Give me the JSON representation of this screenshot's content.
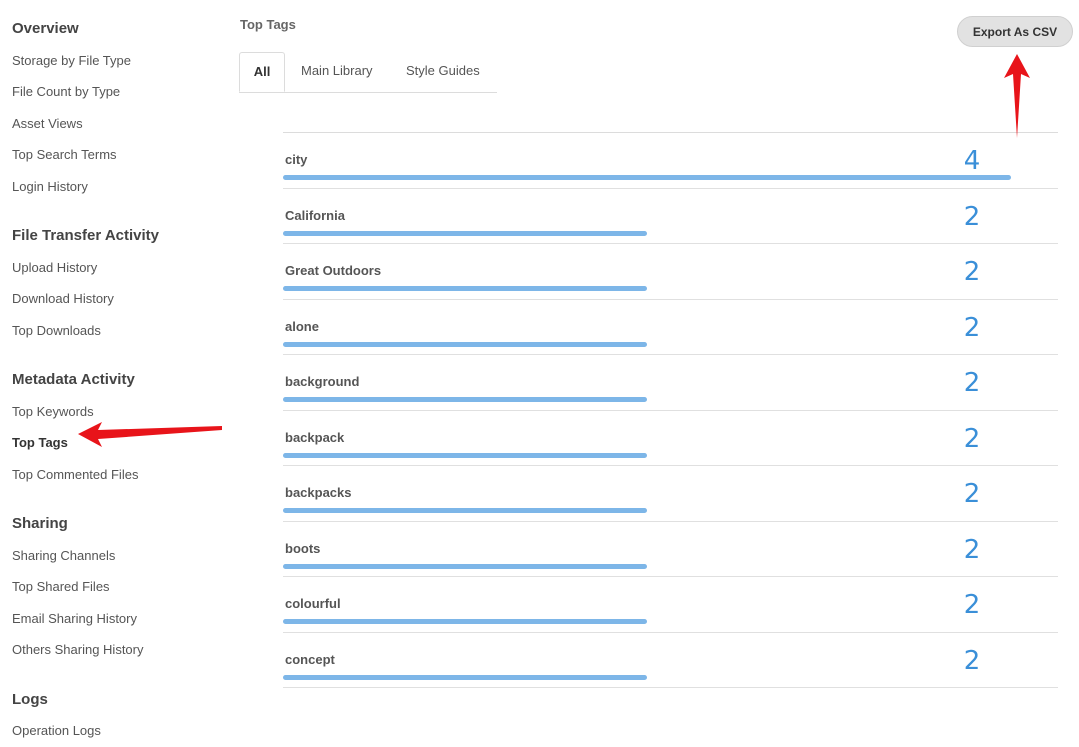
{
  "sidebar": {
    "sections": [
      {
        "title": "Overview",
        "items": [
          "Storage by File Type",
          "File Count by Type",
          "Asset Views",
          "Top Search Terms",
          "Login History"
        ]
      },
      {
        "title": "File Transfer Activity",
        "items": [
          "Upload History",
          "Download History",
          "Top Downloads"
        ]
      },
      {
        "title": "Metadata Activity",
        "items": [
          "Top Keywords",
          "Top Tags",
          "Top Commented Files"
        ]
      },
      {
        "title": "Sharing",
        "items": [
          "Sharing Channels",
          "Top Shared Files",
          "Email Sharing History",
          "Others Sharing History"
        ]
      },
      {
        "title": "Logs",
        "items": [
          "Operation Logs"
        ]
      }
    ],
    "active_item": "Top Tags"
  },
  "header": {
    "title": "Top Tags",
    "export_label": "Export As CSV"
  },
  "tabs": [
    {
      "label": "All",
      "active": true
    },
    {
      "label": "Main Library",
      "active": false
    },
    {
      "label": "Style Guides",
      "active": false
    }
  ],
  "tags": {
    "max_count": 4,
    "bar_color": "#7db6e8",
    "count_color": "#3a8fd8",
    "rows": [
      {
        "name": "city",
        "count": 4
      },
      {
        "name": "California",
        "count": 2
      },
      {
        "name": "Great Outdoors",
        "count": 2
      },
      {
        "name": "alone",
        "count": 2
      },
      {
        "name": "background",
        "count": 2
      },
      {
        "name": "backpack",
        "count": 2
      },
      {
        "name": "backpacks",
        "count": 2
      },
      {
        "name": "boots",
        "count": 2
      },
      {
        "name": "colourful",
        "count": 2
      },
      {
        "name": "concept",
        "count": 2
      }
    ]
  },
  "annotations": {
    "arrow_color": "#e8141a"
  }
}
